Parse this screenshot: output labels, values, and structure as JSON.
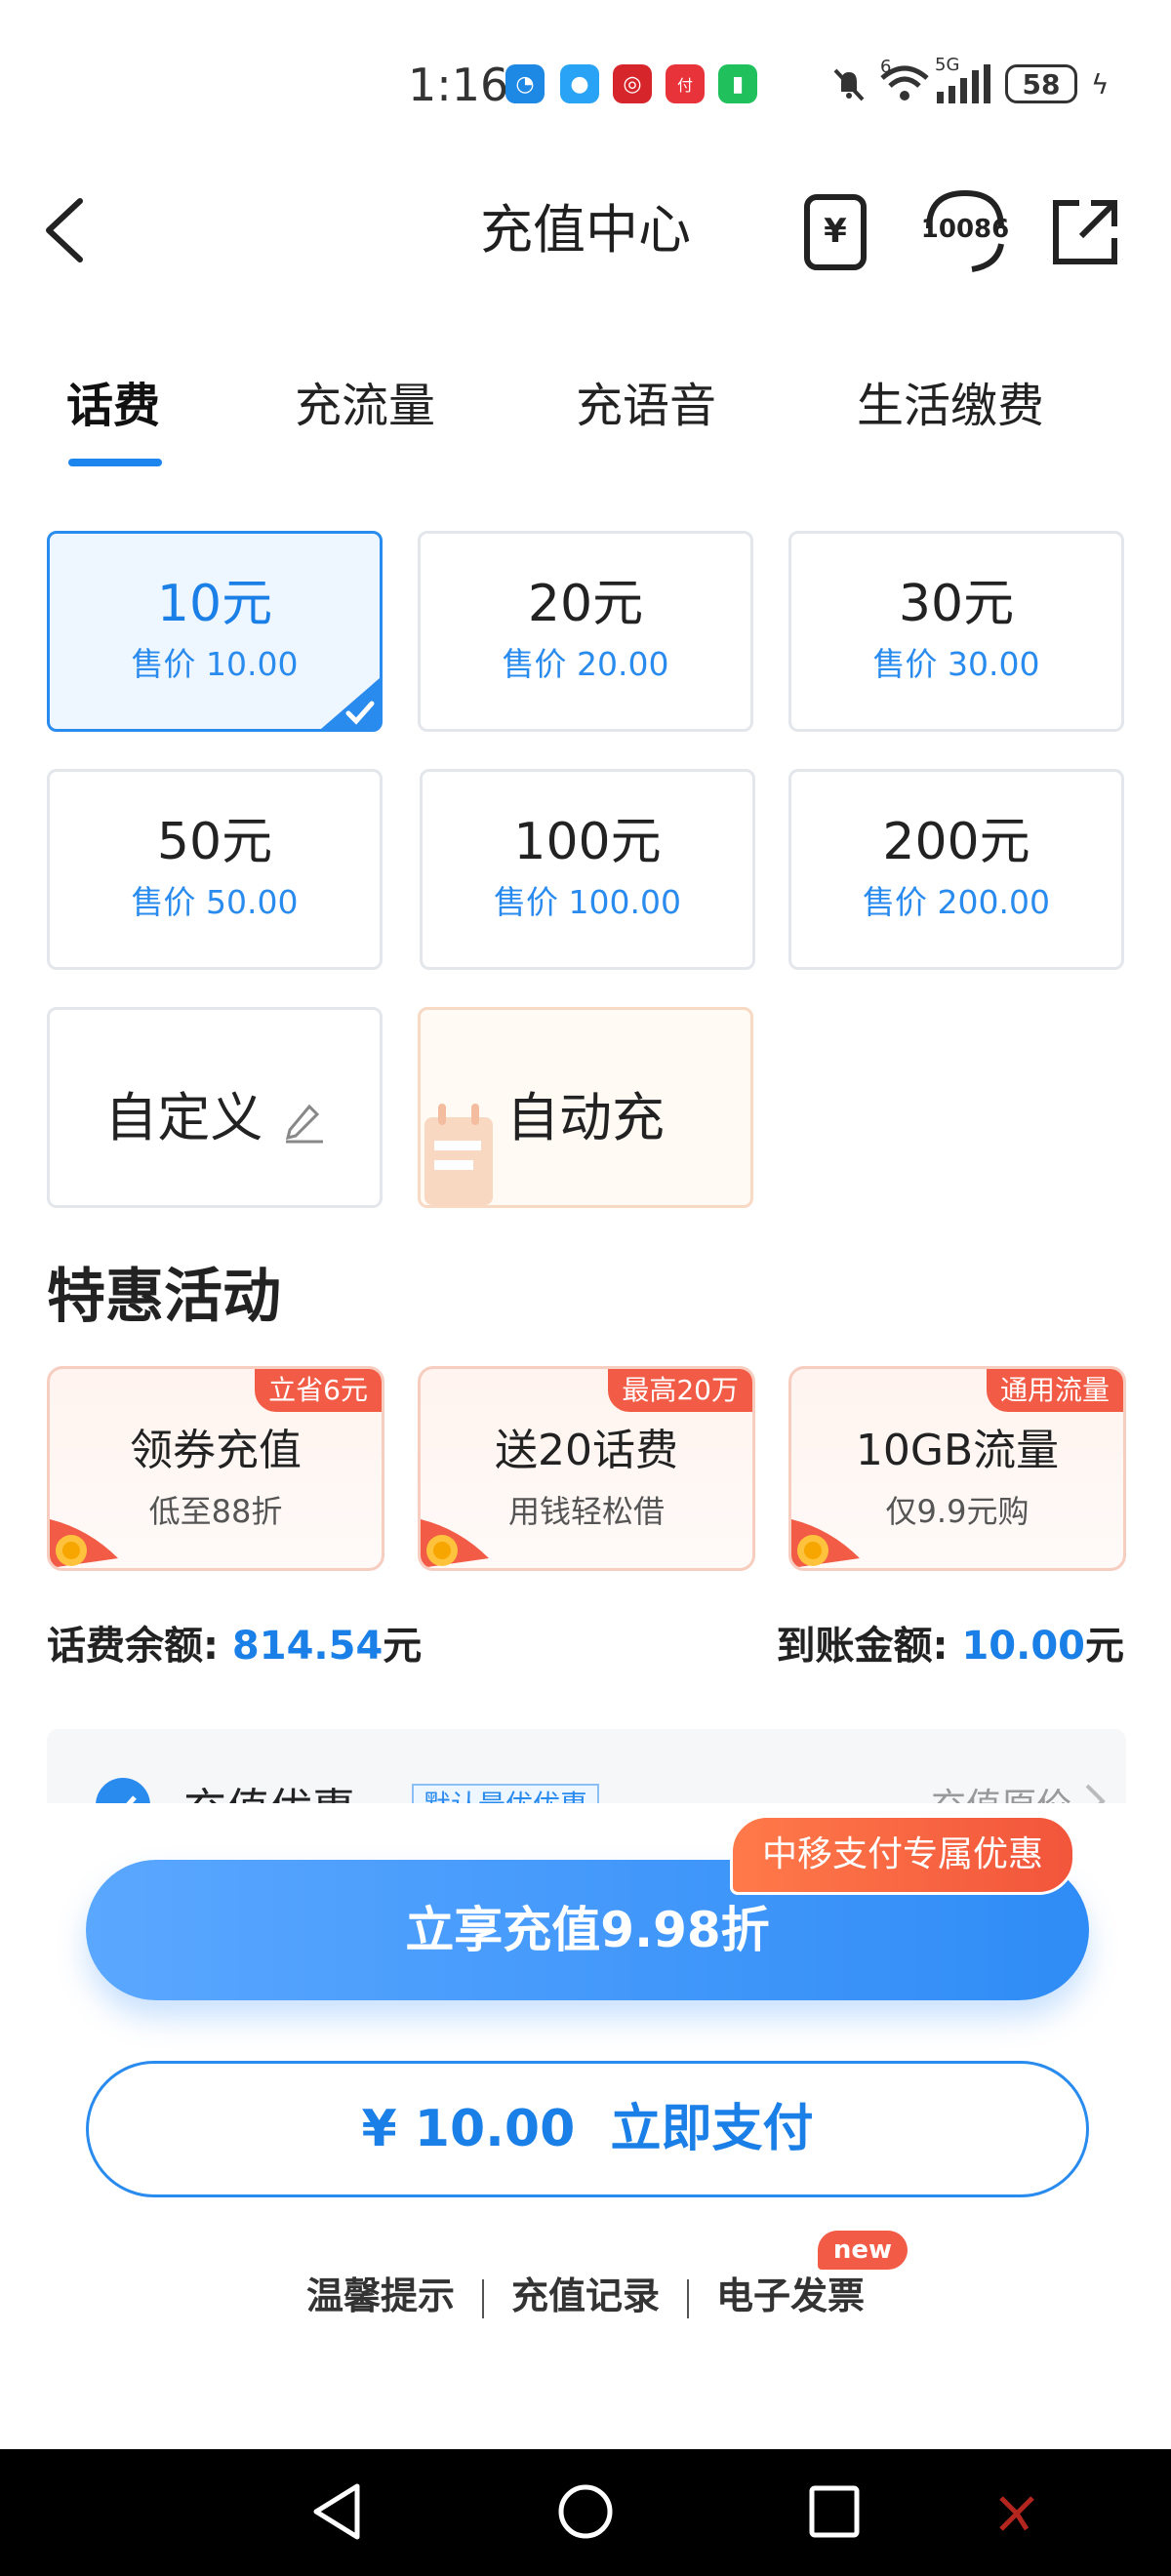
{
  "status_bar": {
    "time": "1:16",
    "network": "5G",
    "battery": "58",
    "wifi_label": "6"
  },
  "header": {
    "title": "充值中心",
    "service_number": "10086",
    "bill_icon_symbol": "¥"
  },
  "tabs": [
    {
      "label": "话费",
      "active": true
    },
    {
      "label": "充流量",
      "active": false
    },
    {
      "label": "充语音",
      "active": false
    },
    {
      "label": "生活缴费",
      "active": false
    }
  ],
  "amounts": [
    {
      "amount": "10元",
      "price": "售价 10.00",
      "selected": true
    },
    {
      "amount": "20元",
      "price": "售价 20.00",
      "selected": false
    },
    {
      "amount": "30元",
      "price": "售价 30.00",
      "selected": false
    },
    {
      "amount": "50元",
      "price": "售价 50.00",
      "selected": false
    },
    {
      "amount": "100元",
      "price": "售价 100.00",
      "selected": false
    },
    {
      "amount": "200元",
      "price": "售价 200.00",
      "selected": false
    }
  ],
  "custom_label": "自定义",
  "auto_label": "自动充",
  "section_title": "特惠活动",
  "promos": [
    {
      "tag": "立省6元",
      "title": "领券充值",
      "sub": "低至88折"
    },
    {
      "tag": "最高20万",
      "title": "送20话费",
      "sub": "用钱轻松借"
    },
    {
      "tag": "通用流量",
      "title": "10GB流量",
      "sub": "仅9.9元购"
    }
  ],
  "balance": {
    "label": "话费余额: ",
    "value": "814.54",
    "unit": "元"
  },
  "arrival": {
    "label": "到账金额: ",
    "value": "10.00",
    "unit": "元"
  },
  "discount_row": {
    "title": "充值优惠",
    "badge": "默认最优优惠",
    "right": "充值原价"
  },
  "actions": {
    "exclusive_badge": "中移支付专属优惠",
    "discount_button": "立享充值9.98折",
    "pay_amount": "¥ 10.00",
    "pay_label": "立即支付"
  },
  "footer_links": [
    "温馨提示",
    "充值记录",
    "电子发票"
  ],
  "new_badge": "new",
  "colors": {
    "accent": "#1a7fe6",
    "promo_tag": "#f25c47",
    "selected_bg": "#eef6ff"
  }
}
